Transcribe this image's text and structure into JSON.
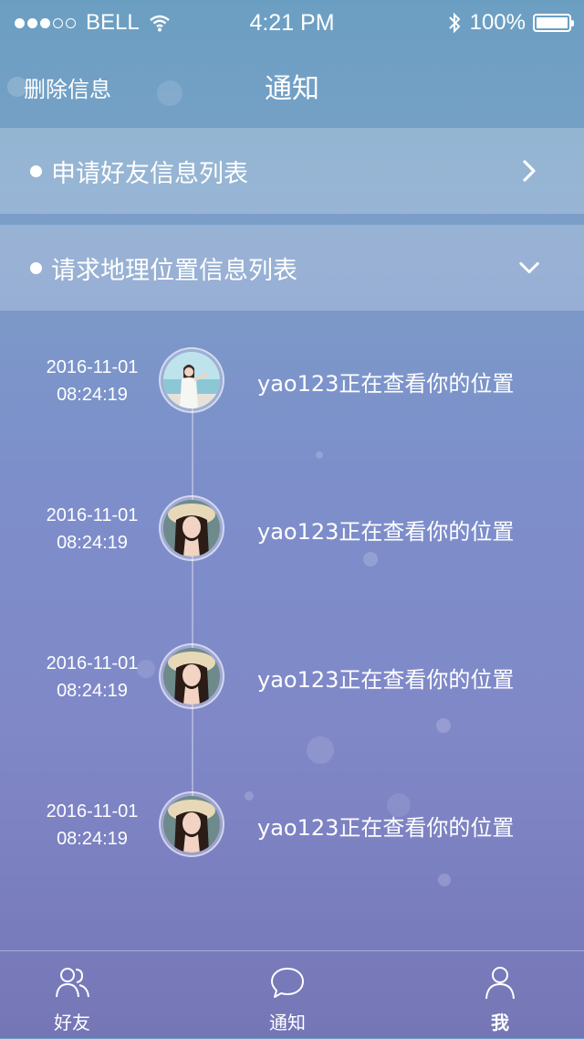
{
  "status_bar": {
    "carrier": "BELL",
    "time": "4:21 PM",
    "battery_percent": "100%",
    "signal_bars_filled": 3,
    "signal_bars_total": 5
  },
  "nav": {
    "left_action": "删除信息",
    "title": "通知"
  },
  "sections": [
    {
      "label": "申请好友信息列表",
      "state": "collapsed",
      "arrow_icon": "chevron-right-icon"
    },
    {
      "label": "请求地理位置信息列表",
      "state": "expanded",
      "arrow_icon": "chevron-down-icon"
    }
  ],
  "timeline": [
    {
      "date": "2016-11-01",
      "time": "08:24:19",
      "text": "yao123正在查看你的位置",
      "avatar": "avatar-beach"
    },
    {
      "date": "2016-11-01",
      "time": "08:24:19",
      "text": "yao123正在查看你的位置",
      "avatar": "avatar-hat"
    },
    {
      "date": "2016-11-01",
      "time": "08:24:19",
      "text": "yao123正在查看你的位置",
      "avatar": "avatar-hat"
    },
    {
      "date": "2016-11-01",
      "time": "08:24:19",
      "text": "yao123正在查看你的位置",
      "avatar": "avatar-hat"
    }
  ],
  "tabs": [
    {
      "label": "好友",
      "icon": "friends-icon",
      "active": false
    },
    {
      "label": "通知",
      "icon": "chat-bubble-icon",
      "active": false
    },
    {
      "label": "我",
      "icon": "person-icon",
      "active": true
    }
  ]
}
